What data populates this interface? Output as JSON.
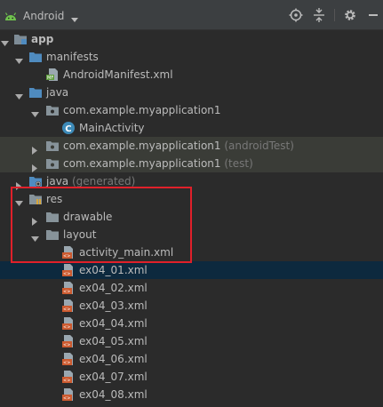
{
  "header": {
    "title": "Android",
    "view_icon": "android-icon",
    "actions": [
      "locate-icon",
      "collapse-all-icon",
      "settings-gear-icon",
      "hide-minus-icon"
    ]
  },
  "tree": {
    "app": "app",
    "manifests": "manifests",
    "android_manifest": "AndroidManifest.xml",
    "java": "java",
    "pkg_main": "com.example.myapplication1",
    "main_activity": "MainActivity",
    "pkg_android_test": "com.example.myapplication1",
    "android_test_suffix": "(androidTest)",
    "pkg_test": "com.example.myapplication1",
    "test_suffix": "(test)",
    "java_generated": "java",
    "generated_suffix": "(generated)",
    "res": "res",
    "drawable": "drawable",
    "layout": "layout",
    "files": [
      "activity_main.xml",
      "ex04_01.xml",
      "ex04_02.xml",
      "ex04_03.xml",
      "ex04_04.xml",
      "ex04_05.xml",
      "ex04_06.xml",
      "ex04_07.xml",
      "ex04_08.xml"
    ]
  },
  "colors": {
    "background": "#2b2b2b",
    "toolbar": "#3c3f41",
    "selection": "#0d293e",
    "highlight_row": "#3a3c37",
    "annotation_box": "#e0202a",
    "folder_blue": "#4f8bbf",
    "android_green": "#6fc44d"
  }
}
